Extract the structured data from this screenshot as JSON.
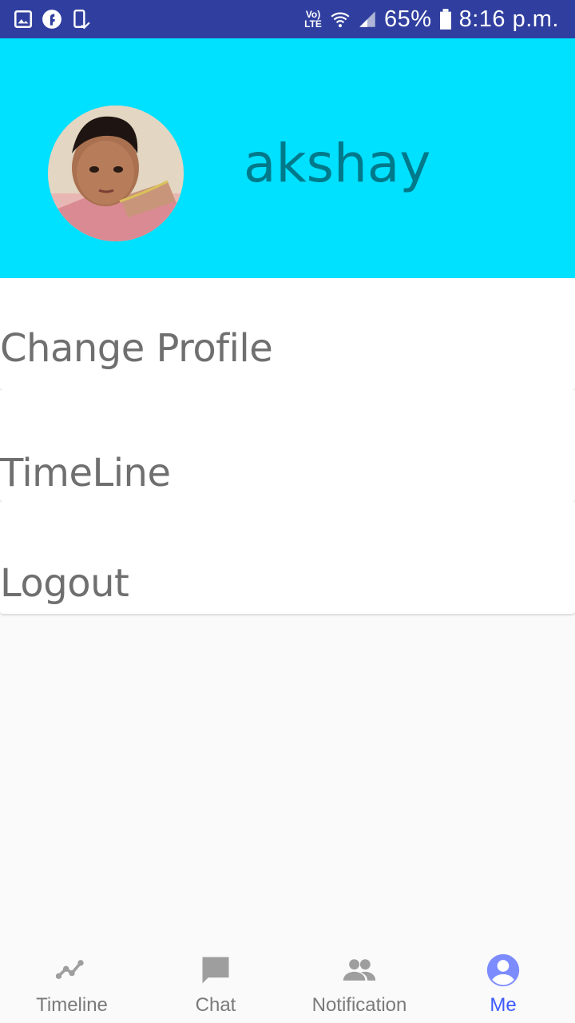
{
  "status_bar": {
    "network_label": "Vo)\nLTE",
    "battery_percent": "65%",
    "time": "8:16 p.m.",
    "left_icons": [
      "gallery-icon",
      "app-f-icon",
      "phone-check-icon"
    ],
    "right_icons": [
      "volte-icon",
      "wifi-icon",
      "signal-icon",
      "battery-icon"
    ],
    "background": "#303f9f"
  },
  "profile": {
    "name": "akshay",
    "header_color": "#00e0ff",
    "name_color": "#00798a"
  },
  "menu": {
    "items": [
      {
        "label": "Change Profile"
      },
      {
        "label": "TimeLine"
      },
      {
        "label": "Logout"
      }
    ]
  },
  "bottom_nav": {
    "items": [
      {
        "label": "Timeline",
        "icon": "timeline-icon",
        "active": false
      },
      {
        "label": "Chat",
        "icon": "chat-icon",
        "active": false
      },
      {
        "label": "Notification",
        "icon": "people-icon",
        "active": false
      },
      {
        "label": "Me",
        "icon": "account-circle-icon",
        "active": true
      }
    ],
    "active_color": "#3d5afe",
    "inactive_color": "#9e9e9e"
  }
}
